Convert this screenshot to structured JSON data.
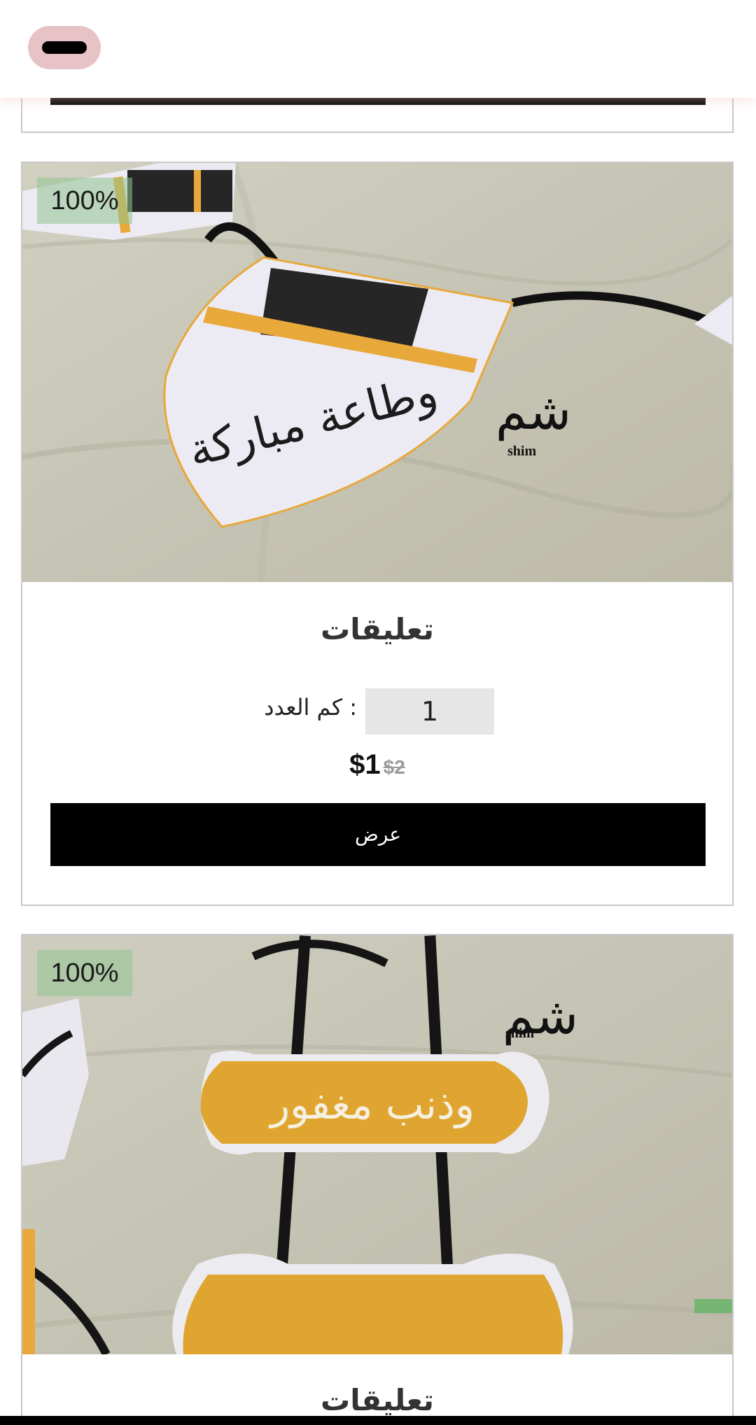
{
  "header": {
    "menu_icon": "menu-pill-icon"
  },
  "products": [
    {
      "discount": "100%",
      "image_text": "وطاعة مباركة",
      "logo_text": "shim",
      "title": "تعليقات",
      "quantity_label": ": كم العدد",
      "quantity_value": "1",
      "price": "$1",
      "original_price": "$2",
      "button_label": "عرض"
    },
    {
      "discount": "100%",
      "image_text": "وذنب مغفور",
      "logo_text": "shim",
      "title": "تعليقات"
    }
  ],
  "colors": {
    "accent_pink": "#e7c2c6",
    "badge_green": "#90c490",
    "button_black": "#000000",
    "fabric": "#c9c7b8",
    "kaaba_gold": "#e8a83a"
  }
}
